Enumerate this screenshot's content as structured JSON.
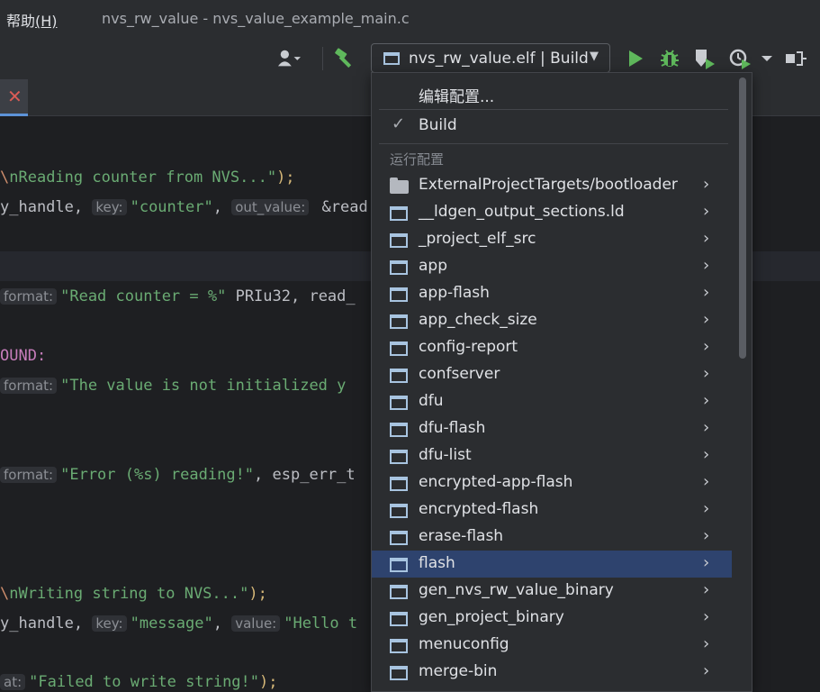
{
  "titlebar": {
    "menu_help": "帮助",
    "menu_help_mnemonic": "(H)",
    "window_title": "nvs_rw_value - nvs_value_example_main.c"
  },
  "toolbar": {
    "config_selector_label": "nvs_rw_value.elf | Build",
    "icons": [
      "user-icon",
      "build-hammer-icon",
      "run-icon",
      "debug-icon",
      "coverage-icon",
      "profile-icon",
      "more-icon",
      "stop-icon"
    ]
  },
  "editor": {
    "lines": [
      {
        "a": "nReading counter from NVS...\"",
        "b": ");"
      },
      {
        "prefix": "y_handle, ",
        "hint1": "key:",
        "val1": "\"counter\"",
        "mid": ", ",
        "hint2": "out_value:",
        "tail": " &read"
      },
      {
        "hint": "format:",
        "str": "\"Read counter = %\"",
        "tail": " PRIu32, read_"
      },
      {
        "text": "OUND:"
      },
      {
        "hint": "format:",
        "str": "\"The value is not initialized y"
      },
      {
        "hint": "format:",
        "str": "\"Error (%s) reading!\"",
        "tail": ", esp_err_t"
      },
      {
        "a": "nWriting string to NVS...\"",
        "b": ");"
      },
      {
        "prefix": "y_handle, ",
        "hint1": "key:",
        "val1": "\"message\"",
        "mid": ", ",
        "hint2": "value:",
        "tail": "\"Hello t"
      },
      {
        "hint": "at:",
        "str": "\"Failed to write string!\"",
        "tail": ");"
      }
    ]
  },
  "popup": {
    "edit_config": "编辑配置...",
    "current_config": "Build",
    "section_label": "运行配置",
    "items": [
      {
        "label": "ExternalProjectTargets/bootloader",
        "icon": "folder-icon"
      },
      {
        "label": "__ldgen_output_sections.ld",
        "icon": "target-icon"
      },
      {
        "label": "_project_elf_src",
        "icon": "target-icon"
      },
      {
        "label": "app",
        "icon": "target-icon"
      },
      {
        "label": "app-flash",
        "icon": "target-icon"
      },
      {
        "label": "app_check_size",
        "icon": "target-icon"
      },
      {
        "label": "config-report",
        "icon": "target-icon"
      },
      {
        "label": "confserver",
        "icon": "target-icon"
      },
      {
        "label": "dfu",
        "icon": "target-icon"
      },
      {
        "label": "dfu-flash",
        "icon": "target-icon"
      },
      {
        "label": "dfu-list",
        "icon": "target-icon"
      },
      {
        "label": "encrypted-app-flash",
        "icon": "target-icon"
      },
      {
        "label": "encrypted-flash",
        "icon": "target-icon"
      },
      {
        "label": "erase-flash",
        "icon": "target-icon"
      },
      {
        "label": "flash",
        "icon": "target-icon",
        "selected": true
      },
      {
        "label": "gen_nvs_rw_value_binary",
        "icon": "target-icon"
      },
      {
        "label": "gen_project_binary",
        "icon": "target-icon"
      },
      {
        "label": "menuconfig",
        "icon": "target-icon"
      },
      {
        "label": "merge-bin",
        "icon": "target-icon"
      }
    ]
  },
  "colors": {
    "selection": "#2e436e",
    "string": "#6aab73",
    "accent": "#5d93d8"
  }
}
